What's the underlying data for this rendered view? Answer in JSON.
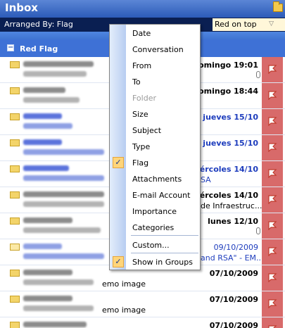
{
  "header": {
    "title": "Inbox",
    "icon": "folder-icon"
  },
  "arrange": {
    "label": "Arranged By: Flag",
    "order": "Red on top",
    "order_chevron": "▽"
  },
  "group": {
    "toggle": "−",
    "label": "Red Flag"
  },
  "rows": [
    {
      "date": "domingo 19:01",
      "subject": "",
      "clip": true
    },
    {
      "date": "domingo 18:44",
      "subject": "",
      "clip": false
    },
    {
      "date": "jueves 15/10",
      "subject": "",
      "clip": false
    },
    {
      "date": "jueves 15/10",
      "subject": "",
      "clip": false
    },
    {
      "date": "iércoles 14/10",
      "subject": "SA",
      "clip": false
    },
    {
      "date": "iércoles 14/10",
      "subject": "de Infraestruc...",
      "clip": false
    },
    {
      "date": "lunes 12/10",
      "subject": "",
      "clip": true
    },
    {
      "date": "09/10/2009",
      "subject": "and RSA\" - EM...",
      "clip": false
    },
    {
      "date": "07/10/2009",
      "subject": "emo image",
      "clip": false
    },
    {
      "date": "07/10/2009",
      "subject": "emo image",
      "clip": false
    },
    {
      "date": "07/10/2009",
      "subject": "",
      "clip": true
    }
  ],
  "menu": {
    "items": [
      {
        "label": "Date",
        "checked": false,
        "disabled": false
      },
      {
        "label": "Conversation",
        "checked": false,
        "disabled": false
      },
      {
        "label": "From",
        "checked": false,
        "disabled": false
      },
      {
        "label": "To",
        "checked": false,
        "disabled": false
      },
      {
        "label": "Folder",
        "checked": false,
        "disabled": true
      },
      {
        "label": "Size",
        "checked": false,
        "disabled": false
      },
      {
        "label": "Subject",
        "checked": false,
        "disabled": false
      },
      {
        "label": "Type",
        "checked": false,
        "disabled": false
      },
      {
        "label": "Flag",
        "checked": true,
        "disabled": false
      },
      {
        "label": "Attachments",
        "checked": false,
        "disabled": false
      },
      {
        "label": "E-mail Account",
        "checked": false,
        "disabled": false
      },
      {
        "label": "Importance",
        "checked": false,
        "disabled": false
      },
      {
        "label": "Categories",
        "checked": false,
        "disabled": false
      }
    ],
    "custom": {
      "label": "Custom...",
      "checked": false
    },
    "show_in_groups": {
      "label": "Show in Groups",
      "checked": true
    },
    "check_glyph": "✓"
  },
  "colors": {
    "accent": "#3e71d6",
    "flag_column": "#d86a6a",
    "arrange_bar": "#0a1f52"
  }
}
